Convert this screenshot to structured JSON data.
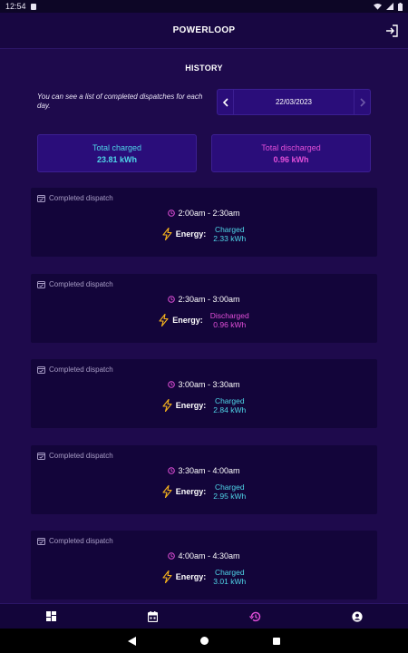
{
  "status_bar": {
    "time": "12:54"
  },
  "app_bar": {
    "title": "POWERLOOP"
  },
  "history": {
    "title": "HISTORY",
    "info": "You can see a list of completed dispatches for each day.",
    "date": "22/03/2023"
  },
  "totals": {
    "charged_label": "Total charged",
    "charged_value": "23.81 kWh",
    "discharged_label": "Total discharged",
    "discharged_value": "0.96 kWh"
  },
  "dispatches": [
    {
      "status": "Completed dispatch",
      "time_range": "2:00am - 2:30am",
      "energy_label": "Energy:",
      "type": "Charged",
      "amount": "2.33 kWh"
    },
    {
      "status": "Completed dispatch",
      "time_range": "2:30am - 3:00am",
      "energy_label": "Energy:",
      "type": "Discharged",
      "amount": "0.96 kWh"
    },
    {
      "status": "Completed dispatch",
      "time_range": "3:00am - 3:30am",
      "energy_label": "Energy:",
      "type": "Charged",
      "amount": "2.84 kWh"
    },
    {
      "status": "Completed dispatch",
      "time_range": "3:30am - 4:00am",
      "energy_label": "Energy:",
      "type": "Charged",
      "amount": "2.95 kWh"
    },
    {
      "status": "Completed dispatch",
      "time_range": "4:00am - 4:30am",
      "energy_label": "Energy:",
      "type": "Charged",
      "amount": "3.01 kWh"
    }
  ],
  "bottom_nav": {
    "items": [
      {
        "icon": "dashboard-icon"
      },
      {
        "icon": "calendar-icon"
      },
      {
        "icon": "history-icon",
        "active": true
      },
      {
        "icon": "account-icon"
      }
    ]
  },
  "colors": {
    "background": "#1e0a4c",
    "card": "#13053a",
    "charged": "#4fd5e8",
    "discharged": "#e24fd9",
    "bolt": "#f5b21c",
    "active_tab": "#e24fd9"
  }
}
